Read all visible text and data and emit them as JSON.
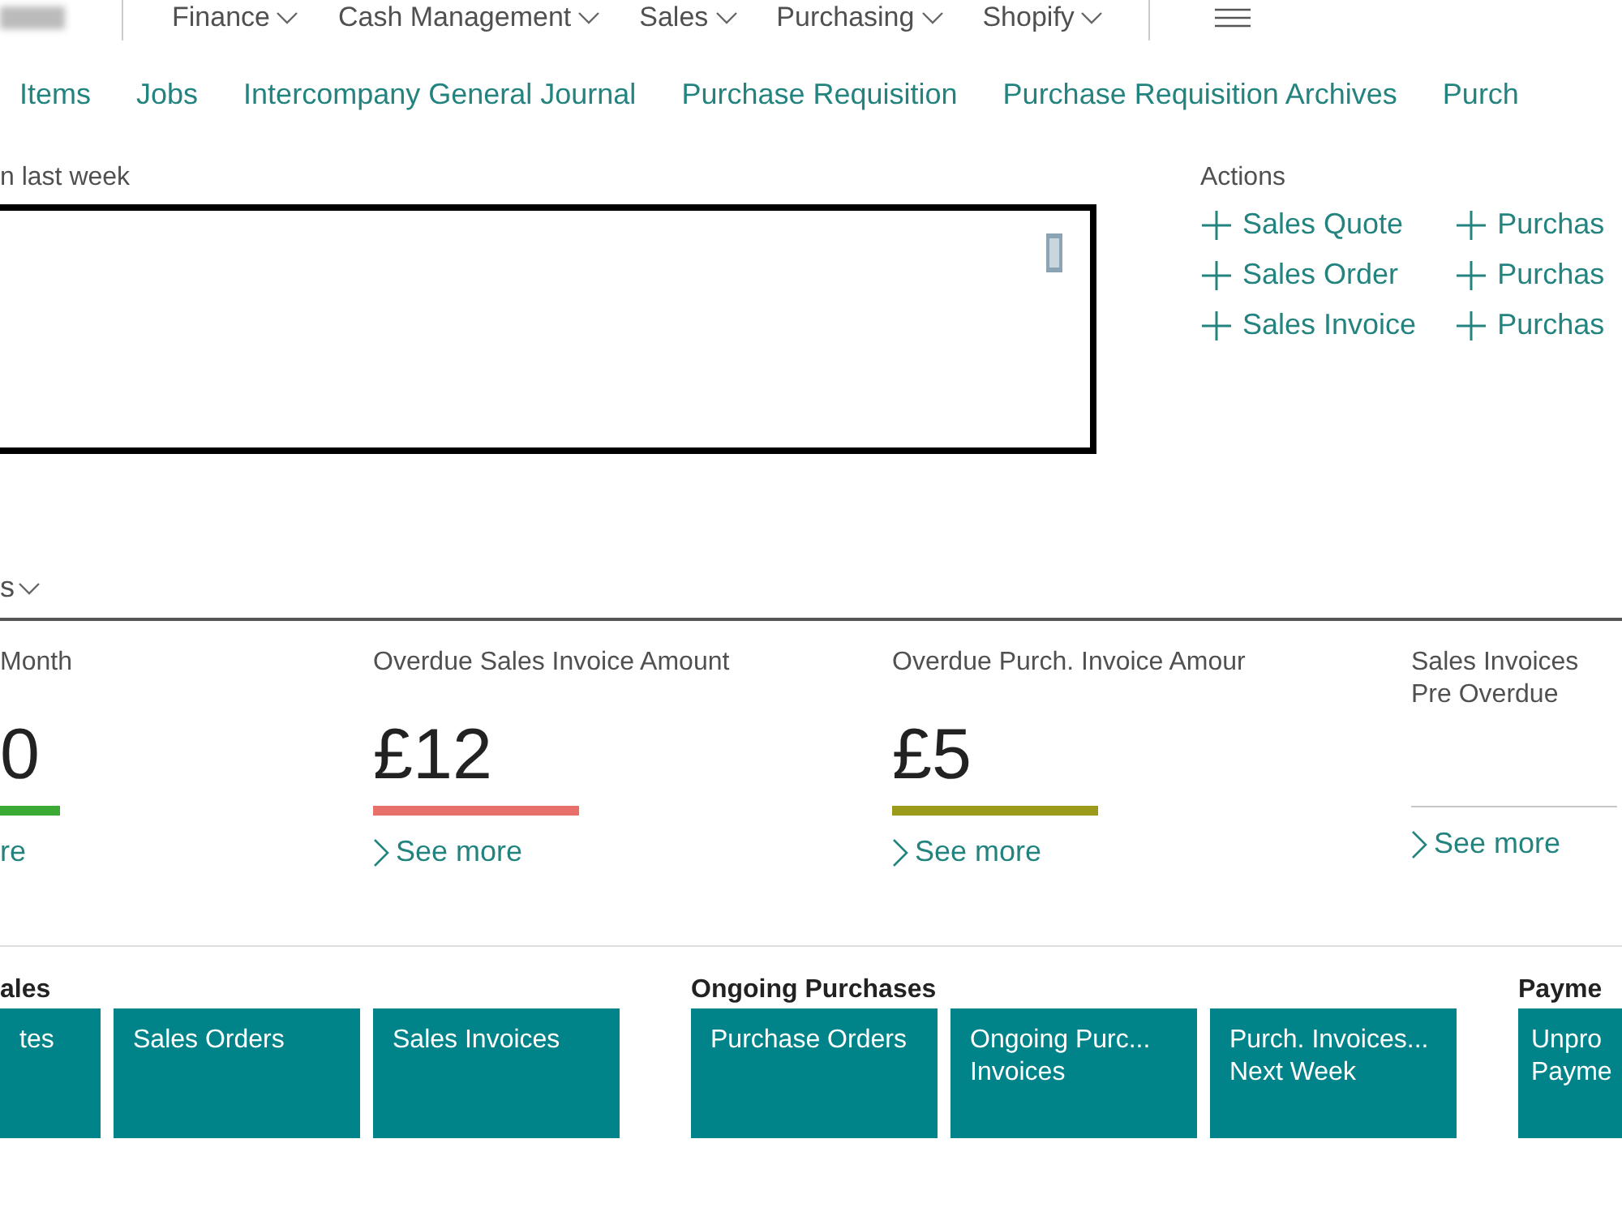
{
  "top_menu": [
    {
      "label": "Finance"
    },
    {
      "label": "Cash Management"
    },
    {
      "label": "Sales"
    },
    {
      "label": "Purchasing"
    },
    {
      "label": "Shopify"
    }
  ],
  "nav_links": [
    "Items",
    "Jobs",
    "Intercompany General Journal",
    "Purchase Requisition",
    "Purchase Requisition Archives",
    "Purch"
  ],
  "chart_panel": {
    "caption": "n last week"
  },
  "actions": {
    "title": "Actions",
    "columns": [
      [
        "Sales Quote",
        "Sales Order",
        "Sales Invoice"
      ],
      [
        "Purchas",
        "Purchas",
        "Purchas"
      ]
    ]
  },
  "kpi_section": {
    "title": "s"
  },
  "kpis": [
    {
      "title": "Month",
      "value": "0",
      "color": "#3aaa35",
      "link": "re"
    },
    {
      "title": "Overdue Sales Invoice Amount",
      "value": "£12",
      "color": "#e8706a",
      "link": "See more"
    },
    {
      "title": "Overdue Purch. Invoice Amour",
      "value": "£5",
      "color": "#9c9a1a",
      "link": "See more"
    },
    {
      "title": "Sales Invoices Pre Overdue",
      "color": "#c8c8c8",
      "link": "See more"
    }
  ],
  "tile_groups": [
    {
      "title": "ales",
      "tiles": [
        "tes",
        "Sales Orders",
        "Sales Invoices"
      ]
    },
    {
      "title": "Ongoing Purchases",
      "tiles": [
        "Purchase Orders",
        "Ongoing Purc... Invoices",
        "Purch. Invoices... Next Week"
      ]
    },
    {
      "title": "Payme",
      "tiles": [
        "Unpro Payme"
      ]
    }
  ]
}
